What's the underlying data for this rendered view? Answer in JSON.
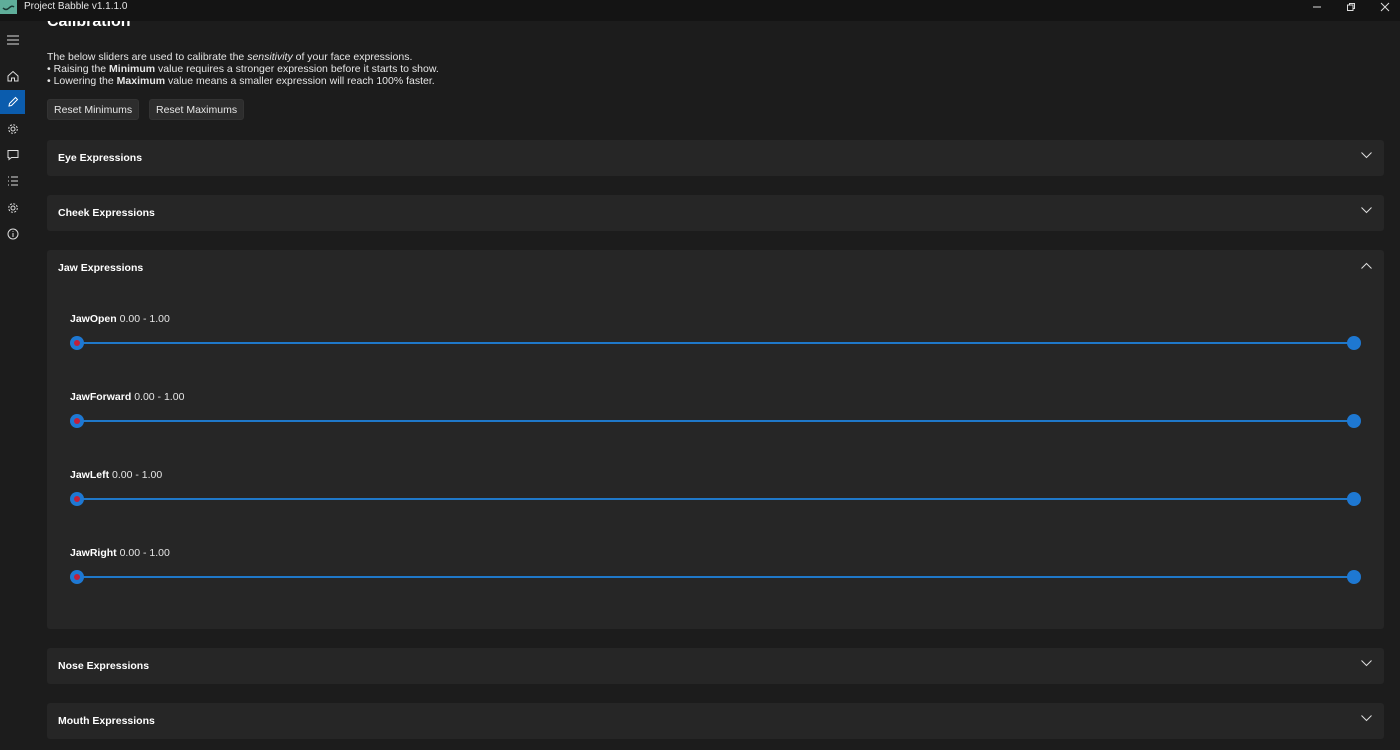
{
  "app": {
    "title": "Project Babble v1.1.1.0"
  },
  "window_controls": [
    "minimize-icon",
    "restore-icon",
    "close-icon"
  ],
  "sidebar": {
    "items": [
      {
        "icon": "hamburger-menu-icon",
        "active": false
      },
      {
        "icon": "home-icon",
        "active": false
      },
      {
        "icon": "pencil-icon",
        "active": true
      },
      {
        "icon": "gear-icon",
        "active": false
      },
      {
        "icon": "chat-bubble-icon",
        "active": false
      },
      {
        "icon": "list-icon",
        "active": false
      },
      {
        "icon": "settings-gear-icon",
        "active": false
      },
      {
        "icon": "info-icon",
        "active": false
      }
    ]
  },
  "calibration": {
    "title": "Calibration",
    "intro": {
      "line1_pre": "The below sliders are used to calibrate the ",
      "line1_em": "sensitivity",
      "line1_post": " of your face expressions.",
      "line2_pre": "• Raising the ",
      "line2_bold": "Minimum",
      "line2_post": " value requires a stronger expression before it starts to show.",
      "line3_pre": "• Lowering the ",
      "line3_bold": "Maximum",
      "line3_post": " value means a smaller expression will reach 100% faster."
    },
    "reset_minimums_label": "Reset Minimums",
    "reset_maximums_label": "Reset Maximums"
  },
  "panels": [
    {
      "title": "Eye Expressions",
      "expanded": false
    },
    {
      "title": "Cheek Expressions",
      "expanded": false
    },
    {
      "title": "Jaw Expressions",
      "expanded": true,
      "sliders": [
        {
          "name": "JawOpen",
          "range_text": "0.00 - 1.00",
          "min": 0.0,
          "max": 1.0
        },
        {
          "name": "JawForward",
          "range_text": "0.00 - 1.00",
          "min": 0.0,
          "max": 1.0
        },
        {
          "name": "JawLeft",
          "range_text": "0.00 - 1.00",
          "min": 0.0,
          "max": 1.0
        },
        {
          "name": "JawRight",
          "range_text": "0.00 - 1.00",
          "min": 0.0,
          "max": 1.0
        }
      ]
    },
    {
      "title": "Nose Expressions",
      "expanded": false
    },
    {
      "title": "Mouth Expressions",
      "expanded": false
    }
  ],
  "colors": {
    "accent": "#0b5cad",
    "slider_track": "#1f78c9",
    "slider_thumb": "#1e78d2",
    "min_thumb_dot": "#c2203a",
    "background": "#1c1c1c",
    "panel": "#262626"
  }
}
